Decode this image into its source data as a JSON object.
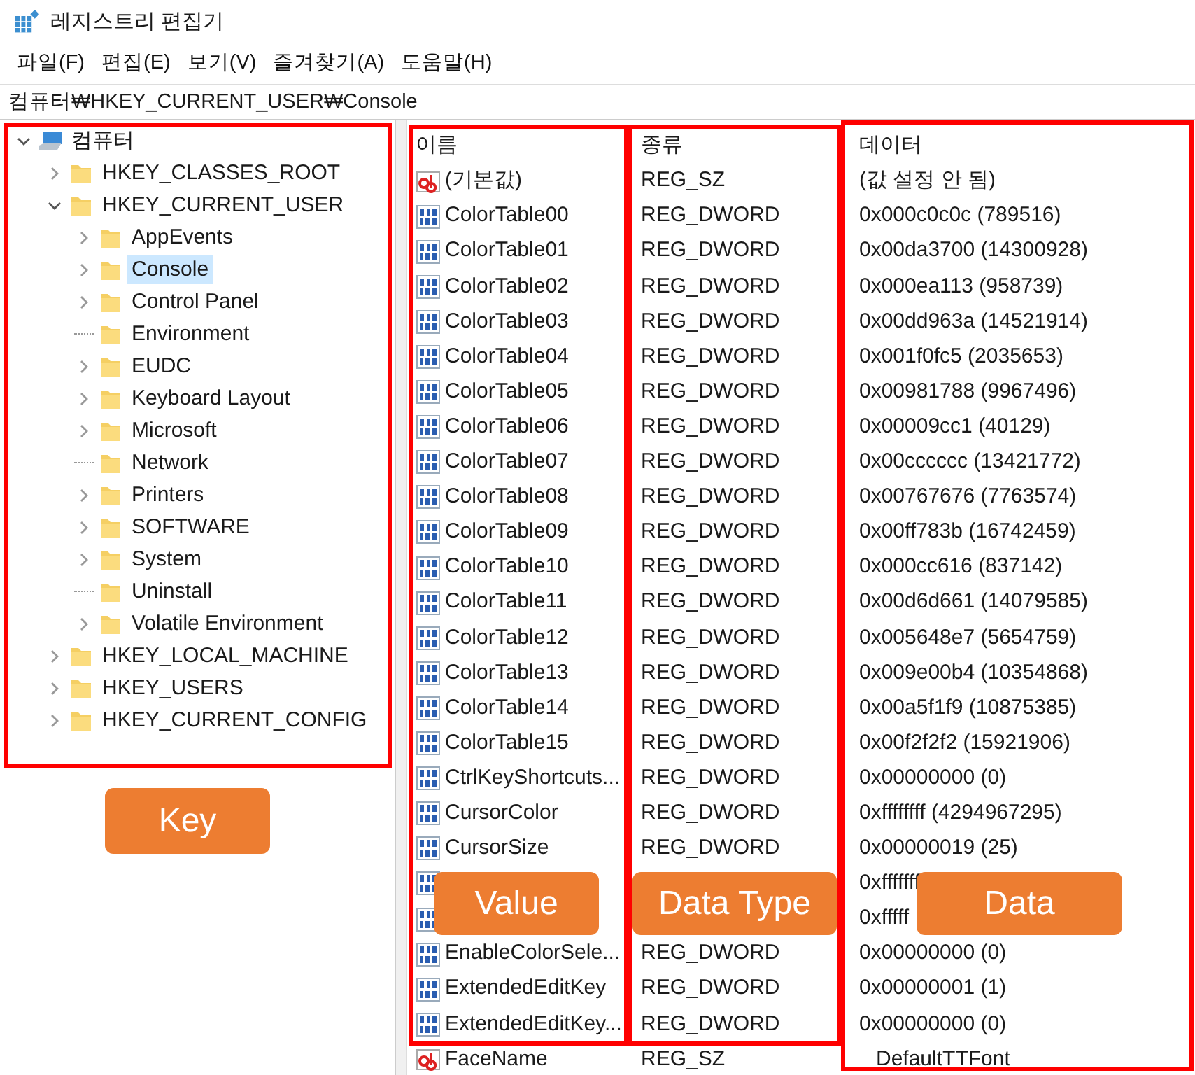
{
  "window": {
    "title": "레지스트리 편집기"
  },
  "menu": [
    "파일(F)",
    "편집(E)",
    "보기(V)",
    "즐겨찾기(A)",
    "도움말(H)"
  ],
  "address": "컴퓨터₩HKEY_CURRENT_USER₩Console",
  "tree": {
    "label": "컴퓨터",
    "kind": "computer",
    "expanded": true,
    "selected": false,
    "children": [
      {
        "label": "HKEY_CLASSES_ROOT",
        "kind": "branch",
        "expanded": false,
        "selected": false
      },
      {
        "label": "HKEY_CURRENT_USER",
        "kind": "branch",
        "expanded": true,
        "selected": false,
        "children": [
          {
            "label": "AppEvents",
            "kind": "branch",
            "expanded": false,
            "selected": false
          },
          {
            "label": "Console",
            "kind": "branch",
            "expanded": false,
            "selected": true
          },
          {
            "label": "Control Panel",
            "kind": "branch",
            "expanded": false,
            "selected": false
          },
          {
            "label": "Environment",
            "kind": "leaf",
            "selected": false
          },
          {
            "label": "EUDC",
            "kind": "branch",
            "expanded": false,
            "selected": false
          },
          {
            "label": "Keyboard Layout",
            "kind": "branch",
            "expanded": false,
            "selected": false
          },
          {
            "label": "Microsoft",
            "kind": "branch",
            "expanded": false,
            "selected": false
          },
          {
            "label": "Network",
            "kind": "leaf",
            "selected": false
          },
          {
            "label": "Printers",
            "kind": "branch",
            "expanded": false,
            "selected": false
          },
          {
            "label": "SOFTWARE",
            "kind": "branch",
            "expanded": false,
            "selected": false
          },
          {
            "label": "System",
            "kind": "branch",
            "expanded": false,
            "selected": false
          },
          {
            "label": "Uninstall",
            "kind": "leaf",
            "selected": false
          },
          {
            "label": "Volatile Environment",
            "kind": "branch",
            "expanded": false,
            "selected": false
          }
        ]
      },
      {
        "label": "HKEY_LOCAL_MACHINE",
        "kind": "branch",
        "expanded": false,
        "selected": false
      },
      {
        "label": "HKEY_USERS",
        "kind": "branch",
        "expanded": false,
        "selected": false
      },
      {
        "label": "HKEY_CURRENT_CONFIG",
        "kind": "branch",
        "expanded": false,
        "selected": false
      }
    ]
  },
  "columns": [
    "이름",
    "종류",
    "데이터"
  ],
  "values": [
    {
      "kind": "string",
      "name": "(기본값)",
      "type": "REG_SZ",
      "data": "(값 설정 안 됨)"
    },
    {
      "kind": "binary",
      "name": "ColorTable00",
      "type": "REG_DWORD",
      "data": "0x000c0c0c (789516)"
    },
    {
      "kind": "binary",
      "name": "ColorTable01",
      "type": "REG_DWORD",
      "data": "0x00da3700 (14300928)"
    },
    {
      "kind": "binary",
      "name": "ColorTable02",
      "type": "REG_DWORD",
      "data": "0x000ea113 (958739)"
    },
    {
      "kind": "binary",
      "name": "ColorTable03",
      "type": "REG_DWORD",
      "data": "0x00dd963a (14521914)"
    },
    {
      "kind": "binary",
      "name": "ColorTable04",
      "type": "REG_DWORD",
      "data": "0x001f0fc5 (2035653)"
    },
    {
      "kind": "binary",
      "name": "ColorTable05",
      "type": "REG_DWORD",
      "data": "0x00981788 (9967496)"
    },
    {
      "kind": "binary",
      "name": "ColorTable06",
      "type": "REG_DWORD",
      "data": "0x00009cc1 (40129)"
    },
    {
      "kind": "binary",
      "name": "ColorTable07",
      "type": "REG_DWORD",
      "data": "0x00cccccc (13421772)"
    },
    {
      "kind": "binary",
      "name": "ColorTable08",
      "type": "REG_DWORD",
      "data": "0x00767676 (7763574)"
    },
    {
      "kind": "binary",
      "name": "ColorTable09",
      "type": "REG_DWORD",
      "data": "0x00ff783b (16742459)"
    },
    {
      "kind": "binary",
      "name": "ColorTable10",
      "type": "REG_DWORD",
      "data": "0x000cc616 (837142)"
    },
    {
      "kind": "binary",
      "name": "ColorTable11",
      "type": "REG_DWORD",
      "data": "0x00d6d661 (14079585)"
    },
    {
      "kind": "binary",
      "name": "ColorTable12",
      "type": "REG_DWORD",
      "data": "0x005648e7 (5654759)"
    },
    {
      "kind": "binary",
      "name": "ColorTable13",
      "type": "REG_DWORD",
      "data": "0x009e00b4 (10354868)"
    },
    {
      "kind": "binary",
      "name": "ColorTable14",
      "type": "REG_DWORD",
      "data": "0x00a5f1f9 (10875385)"
    },
    {
      "kind": "binary",
      "name": "ColorTable15",
      "type": "REG_DWORD",
      "data": "0x00f2f2f2 (15921906)"
    },
    {
      "kind": "binary",
      "name": "CtrlKeyShortcuts...",
      "type": "REG_DWORD",
      "data": "0x00000000 (0)"
    },
    {
      "kind": "binary",
      "name": "CursorColor",
      "type": "REG_DWORD",
      "data": "0xffffffff (4294967295)"
    },
    {
      "kind": "binary",
      "name": "CursorSize",
      "type": "REG_DWORD",
      "data": "0x00000019 (25)"
    },
    {
      "kind": "binary",
      "data": "0xfffffff"
    },
    {
      "kind": "binary",
      "data": "0xfffff"
    },
    {
      "kind": "binary",
      "name": "EnableColorSele...",
      "type": "REG_DWORD",
      "data": "0x00000000 (0)"
    },
    {
      "kind": "binary",
      "name": "ExtendedEditKey",
      "type": "REG_DWORD",
      "data": "0x00000001 (1)"
    },
    {
      "kind": "binary",
      "name": "ExtendedEditKey...",
      "type": "REG_DWORD",
      "data": "0x00000000 (0)"
    },
    {
      "kind": "string",
      "name": "FaceName",
      "type": "REG_SZ",
      "data": "DefaultTTFont"
    }
  ],
  "callouts": [
    {
      "label": "Key"
    },
    {
      "label": "Value"
    },
    {
      "label": "Data Type"
    },
    {
      "label": "Data"
    }
  ]
}
